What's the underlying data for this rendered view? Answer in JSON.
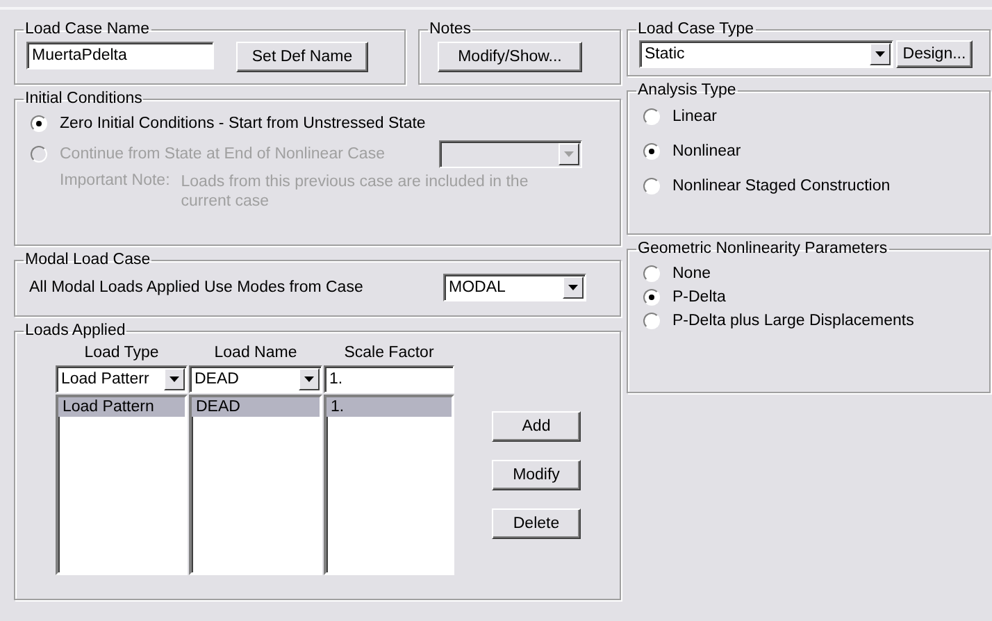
{
  "load_case_name": {
    "title": "Load Case Name",
    "value": "MuertaPdelta",
    "button": "Set Def Name"
  },
  "notes": {
    "title": "Notes",
    "button": "Modify/Show..."
  },
  "initial_conditions": {
    "title": "Initial Conditions",
    "options": [
      {
        "label": "Zero Initial Conditions - Start from Unstressed State",
        "selected": true,
        "disabled": false
      },
      {
        "label": "Continue from State at End of Nonlinear Case",
        "selected": false,
        "disabled": true
      }
    ],
    "case_select": {
      "disabled": true
    },
    "note_label": "Important Note:",
    "note": "Loads from this previous case are included in the current case"
  },
  "modal_load_case": {
    "title": "Modal Load Case",
    "label": "All Modal Loads Applied Use Modes from Case",
    "value": "MODAL"
  },
  "loads_applied": {
    "title": "Loads Applied",
    "columns": [
      "Load Type",
      "Load Name",
      "Scale Factor"
    ],
    "entry": {
      "load_type": "Load Patterr",
      "load_name": "DEAD",
      "scale_factor": "1."
    },
    "rows": [
      {
        "cells": [
          "Load Pattern",
          "DEAD",
          "1."
        ],
        "selected": true
      }
    ],
    "buttons": [
      "Add",
      "Modify",
      "Delete"
    ]
  },
  "load_case_type": {
    "title": "Load Case Type",
    "value": "Static",
    "button": "Design..."
  },
  "analysis_type": {
    "title": "Analysis Type",
    "options": [
      {
        "label": "Linear",
        "selected": false
      },
      {
        "label": "Nonlinear",
        "selected": true
      },
      {
        "label": "Nonlinear Staged Construction",
        "selected": false
      }
    ]
  },
  "geometric_nonlinearity": {
    "title": "Geometric Nonlinearity Parameters",
    "options": [
      {
        "label": "None",
        "selected": false
      },
      {
        "label": "P-Delta",
        "selected": true
      },
      {
        "label": "P-Delta plus Large Displacements",
        "selected": false
      }
    ]
  }
}
